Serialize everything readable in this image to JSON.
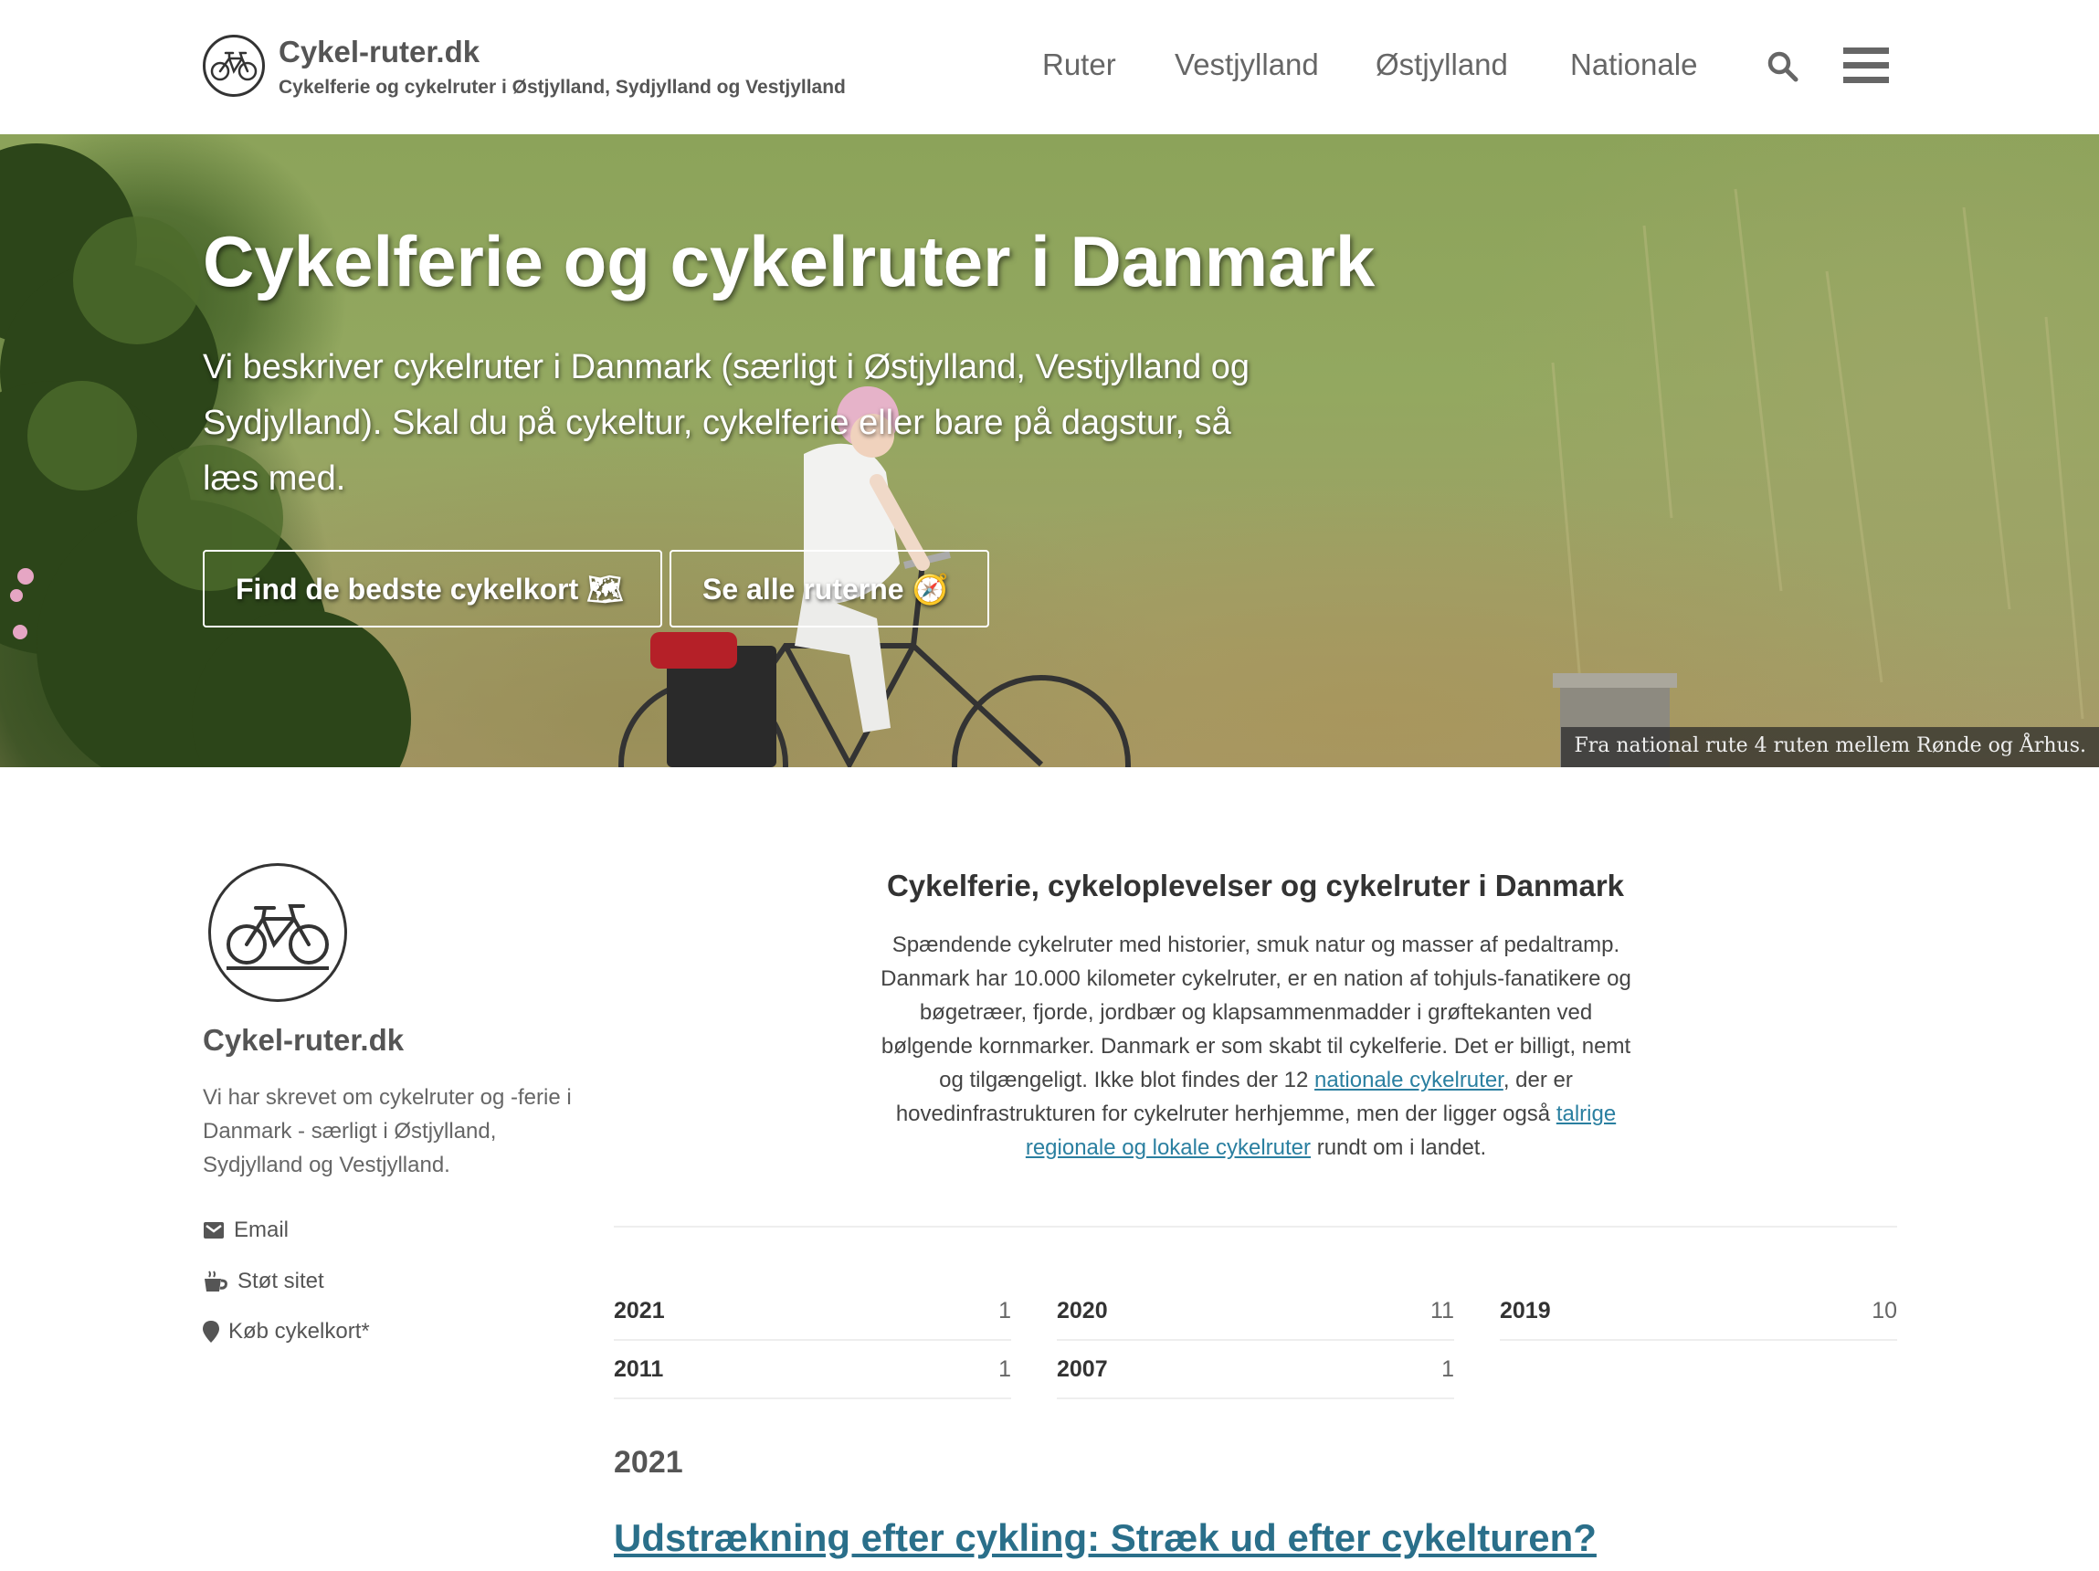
{
  "header": {
    "site_title": "Cykel-ruter.dk",
    "tagline": "Cykelferie og cykelruter i Østjylland, Sydjylland og Vestjylland",
    "nav": [
      "Ruter",
      "Vestjylland",
      "Østjylland",
      "Nationale"
    ],
    "search_icon": "search-icon",
    "menu_icon": "hamburger-menu-icon"
  },
  "hero": {
    "title": "Cykelferie og cykelruter i Danmark",
    "text": "Vi beskriver cykelruter i Danmark (særligt i Østjylland, Vestjylland og Sydjylland). Skal du på cykeltur, cykelferie eller bare på dagstur, så læs med.",
    "button_maps": "Find de bedste cykelkort 🗺",
    "button_routes": "Se alle ruterne 🧭",
    "caption": "Fra national rute 4 ruten mellem Rønde og Århus."
  },
  "sidebar": {
    "name": "Cykel-ruter.dk",
    "description": "Vi har skrevet om cykelruter og -ferie i Danmark - særligt i Østjylland, Sydjylland og Vestjylland.",
    "links": [
      {
        "label": "Email",
        "icon": "email-icon"
      },
      {
        "label": "Støt sitet",
        "icon": "coffee-icon"
      },
      {
        "label": "Køb cykelkort*",
        "icon": "map-pin-icon"
      }
    ]
  },
  "intro": {
    "title": "Cykelferie, cykeloplevelser og cykelruter i Danmark",
    "text_1": "Spændende cykelruter med historier, smuk natur og masser af pedaltramp. Danmark har 10.000 kilometer cykelruter, er en nation af tohjuls-fanatikere og bøgetræer, fjorde, jordbær og klapsammenmadder i grøftekanten ved bølgende kornmarker. Danmark er som skabt til cykelferie. Det er billigt, nemt og tilgængeligt. Ikke blot findes der 12 ",
    "link_1": "nationale cykelruter",
    "text_2": ", der er hovedinfrastrukturen for cykelruter herhjemme, men der ligger også ",
    "link_2": "talrige regionale og lokale cykelruter",
    "text_3": " rundt om i landet."
  },
  "archive": [
    {
      "year": "2021",
      "count": "1"
    },
    {
      "year": "2020",
      "count": "11"
    },
    {
      "year": "2019",
      "count": "10"
    },
    {
      "year": "2011",
      "count": "1"
    },
    {
      "year": "2007",
      "count": "1"
    }
  ],
  "posts": {
    "year_heading": "2021",
    "first_title": "Udstrækning efter cykling: Stræk ud efter cykelturen?"
  },
  "colors": {
    "link": "#2a7fa0",
    "post_title": "#2a6f8a",
    "text_dark": "#333333",
    "nav_text": "#666666"
  }
}
